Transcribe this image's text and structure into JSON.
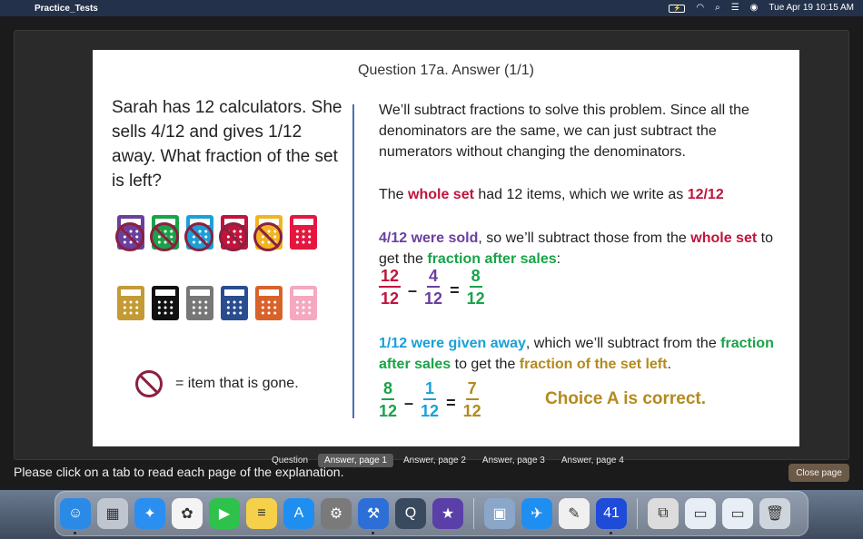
{
  "menubar": {
    "app_name": "Practice_Tests",
    "datetime": "Tue Apr 19  10:15 AM"
  },
  "slide": {
    "title": "Question 17a. Answer (1/1)",
    "problem": "Sarah has 12 calculators. She sells 4/12 and gives 1/12 away. What fraction of the set is left?",
    "legend_text": "= item that is gone.",
    "calculators_row1": [
      {
        "color": "#6b3fa0",
        "gone": true
      },
      {
        "color": "#19a349",
        "gone": true
      },
      {
        "color": "#1aa0d8",
        "gone": true
      },
      {
        "color": "#c0143c",
        "gone": true
      },
      {
        "color": "#f2b420",
        "gone": true
      },
      {
        "color": "#e5173f",
        "gone": false
      }
    ],
    "calculators_row2": [
      {
        "color": "#c49a35",
        "gone": false
      },
      {
        "color": "#111111",
        "gone": false
      },
      {
        "color": "#777777",
        "gone": false
      },
      {
        "color": "#2a4d8f",
        "gone": false
      },
      {
        "color": "#d9622b",
        "gone": false
      },
      {
        "color": "#f5a8c0",
        "gone": false
      }
    ],
    "p1": "We’ll subtract fractions to solve this problem. Since all the denominators are the same, we can just subtract the numerators without changing the denominators.",
    "p2": {
      "a": "The ",
      "b": "whole set",
      "c": " had 12 items, which we write as ",
      "d": "12/12"
    },
    "p3": {
      "a": "4/12 were sold",
      "b": ", so we’ll subtract those from the ",
      "c": "whole set",
      "d": " to get the ",
      "e": "fraction after sales",
      "f": ":"
    },
    "eq1": {
      "n1": "12",
      "d1": "12",
      "op1": "–",
      "n2": "4",
      "d2": "12",
      "op2": "=",
      "n3": "8",
      "d3": "12"
    },
    "p4": {
      "a": "1/12 were given away",
      "b": ", which we’ll subtract from the ",
      "c": "fraction after sales",
      "d": " to get the ",
      "e": "fraction of the set left",
      "f": "."
    },
    "eq2": {
      "n1": "8",
      "d1": "12",
      "op1": "–",
      "n2": "1",
      "d2": "12",
      "op2": "=",
      "n3": "7",
      "d3": "12"
    },
    "choice": "Choice A is correct."
  },
  "tabs": [
    {
      "label": "Question",
      "active": false
    },
    {
      "label": "Answer, page 1",
      "active": true
    },
    {
      "label": "Answer, page 2",
      "active": false
    },
    {
      "label": "Answer, page 3",
      "active": false
    },
    {
      "label": "Answer, page 4",
      "active": false
    }
  ],
  "instruction": "Please click on a tab to read each page of the explanation.",
  "close_label": "Close page",
  "dock": [
    {
      "name": "finder-icon",
      "glyph": "☺",
      "bg": "#2b8ae6",
      "run": true
    },
    {
      "name": "launchpad-icon",
      "glyph": "▦",
      "bg": "#c0c6d0",
      "run": false
    },
    {
      "name": "safari-icon",
      "glyph": "✦",
      "bg": "#2a8ff0",
      "run": false
    },
    {
      "name": "photos-icon",
      "glyph": "✿",
      "bg": "#f4f4f4",
      "run": false
    },
    {
      "name": "facetime-icon",
      "glyph": "▶",
      "bg": "#2ec24d",
      "run": false
    },
    {
      "name": "notes-icon",
      "glyph": "≡",
      "bg": "#f5d04a",
      "run": false
    },
    {
      "name": "app-store-icon",
      "glyph": "A",
      "bg": "#1f8ef1",
      "run": false
    },
    {
      "name": "system-preferences-icon",
      "glyph": "⚙",
      "bg": "#7a7a7a",
      "run": false
    },
    {
      "name": "xcode-icon",
      "glyph": "⚒",
      "bg": "#2d6fd6",
      "run": true
    },
    {
      "name": "quicktime-icon",
      "glyph": "Q",
      "bg": "#3a4a5e",
      "run": false
    },
    {
      "name": "imovie-icon",
      "glyph": "★",
      "bg": "#5b3fa8",
      "run": false
    },
    {
      "name": "preview-icon",
      "glyph": "▣",
      "bg": "#8aa6c8",
      "run": false
    },
    {
      "name": "testflight-icon",
      "glyph": "✈",
      "bg": "#1f8ef1",
      "run": false
    },
    {
      "name": "textedit-icon",
      "glyph": "✎",
      "bg": "#f0f0f0",
      "run": false
    },
    {
      "name": "calculator-app-icon",
      "glyph": "41",
      "bg": "#1e4bd8",
      "run": true
    },
    {
      "name": "archive-utility-icon",
      "glyph": "⧉",
      "bg": "#dcdcdc",
      "run": false
    },
    {
      "name": "window-thumbnail-1-icon",
      "glyph": "▭",
      "bg": "#e8eef6",
      "run": false
    },
    {
      "name": "window-thumbnail-2-icon",
      "glyph": "▭",
      "bg": "#e8eef6",
      "run": false
    },
    {
      "name": "trash-icon",
      "glyph": "🗑",
      "bg": "#cfd5dd",
      "run": false
    }
  ]
}
